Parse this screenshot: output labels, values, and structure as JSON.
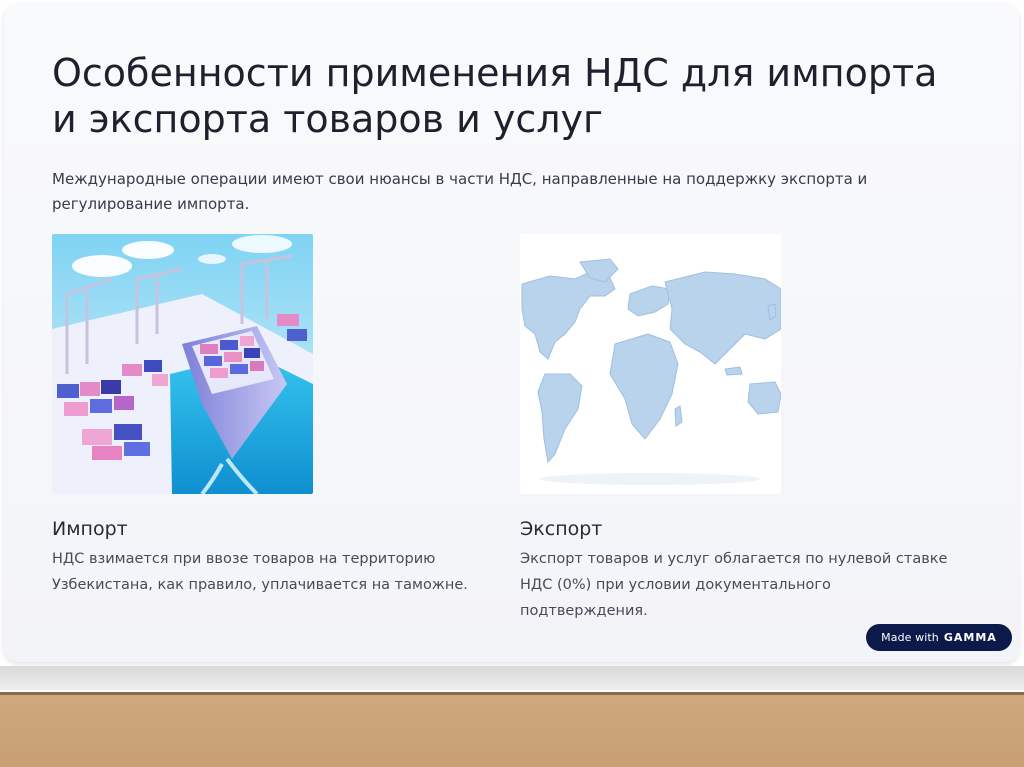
{
  "slide": {
    "title": "Особенности применения НДС для импорта и экспорта товаров и услуг",
    "subtitle": "Международные операции имеют свои нюансы в части НДС, направленные на поддержку экспорта и регулирование импорта."
  },
  "cards": [
    {
      "image": "container-port-ship-illustration",
      "title": "Импорт",
      "text": "НДС взимается при ввозе товаров на территорию Узбекистана, как правило, уплачивается на таможне."
    },
    {
      "image": "world-map-illustration",
      "title": "Экспорт",
      "text": "Экспорт товаров и услуг облагается по нулевой ставке НДС (0%) при условии документального подтверждения."
    }
  ],
  "badge": {
    "prefix": "Made with",
    "brand": "GAMMA"
  },
  "colors": {
    "badge_bg": "#0c1a4b",
    "slide_bg": "#f7f8fb",
    "map_fill": "#b9d3ec",
    "water": "#2fb6e6"
  }
}
